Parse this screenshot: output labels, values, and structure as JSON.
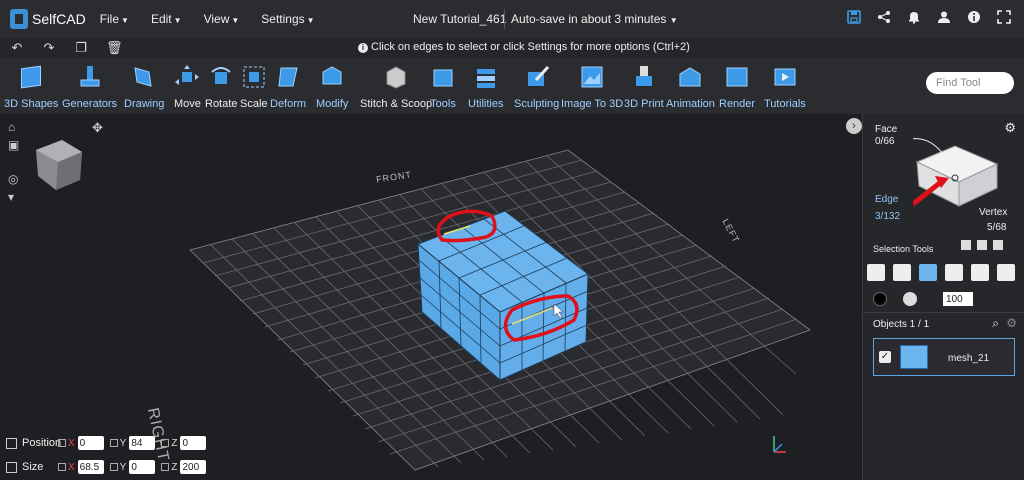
{
  "app": {
    "logo_text": "SelfCAD",
    "brand_color": "#3d9ae8"
  },
  "menu": [
    {
      "label": "File"
    },
    {
      "label": "Edit"
    },
    {
      "label": "View"
    },
    {
      "label": "Settings"
    }
  ],
  "header": {
    "title": "New Tutorial_461",
    "autosave": "Auto-save in about 3 minutes"
  },
  "top_icons": [
    "save-icon",
    "share-icon",
    "bell-icon",
    "user-icon",
    "info-icon",
    "fullscreen-icon"
  ],
  "hint": {
    "text": "Click on edges to select or click Settings for more options (Ctrl+2)"
  },
  "toolbar": {
    "tools": [
      {
        "label": "3D Shapes"
      },
      {
        "label": "Generators"
      },
      {
        "label": "Drawing"
      },
      {
        "label": "Move"
      },
      {
        "label": "Rotate"
      },
      {
        "label": "Scale"
      },
      {
        "label": "Deform"
      },
      {
        "label": "Modify"
      },
      {
        "label": "Stitch & Scoop"
      },
      {
        "label": "Tools"
      },
      {
        "label": "Utilities"
      },
      {
        "label": "Sculpting"
      },
      {
        "label": "Image To 3D"
      },
      {
        "label": "3D Print"
      },
      {
        "label": "Animation"
      },
      {
        "label": "Render"
      },
      {
        "label": "Tutorials"
      }
    ],
    "find_placeholder": "Find Tool"
  },
  "viewport": {
    "labels": {
      "front": "FRONT",
      "left": "LEFT",
      "right": "RIGHT"
    },
    "model_color": "#6bb4ee",
    "annotation_color": "#e0101a"
  },
  "transform": {
    "position": {
      "label": "Position",
      "x": "0",
      "y": "84",
      "z": "0"
    },
    "size": {
      "label": "Size",
      "x": "68.5",
      "y": "0",
      "z": "200"
    }
  },
  "panel": {
    "face_label": "Face",
    "face_count": "0/66",
    "edge_label": "Edge",
    "edge_count": "3/132",
    "vertex_label": "Vertex",
    "vertex_count": "5/68",
    "selection_tools_label": "Selection Tools",
    "opacity_value": "100",
    "objects_label": "Objects 1 / 1",
    "objects": [
      {
        "name": "mesh_21"
      }
    ]
  }
}
